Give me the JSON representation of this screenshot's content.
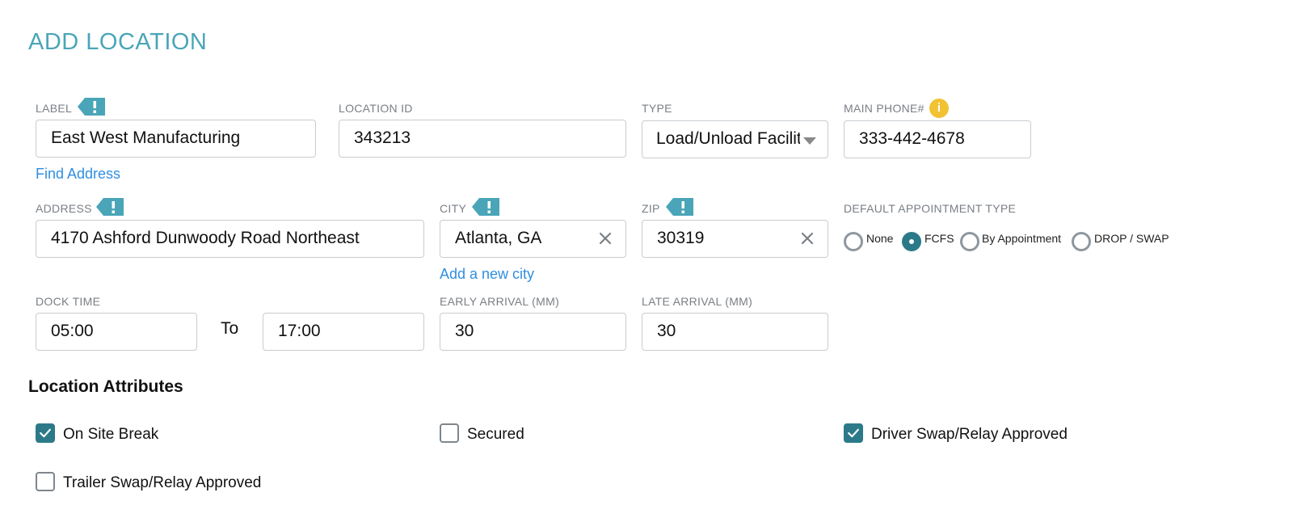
{
  "page_title": "ADD LOCATION",
  "fields": {
    "label": {
      "label": "LABEL",
      "value": "East West Manufacturing"
    },
    "location_id": {
      "label": "LOCATION ID",
      "value": "343213"
    },
    "type": {
      "label": "TYPE",
      "value": "Load/Unload Facility"
    },
    "main_phone": {
      "label": "MAIN PHONE#",
      "value": "333-442-4678"
    },
    "address": {
      "label": "ADDRESS",
      "value": "4170 Ashford Dunwoody Road Northeast"
    },
    "city": {
      "label": "CITY",
      "value": "Atlanta, GA"
    },
    "zip": {
      "label": "ZIP",
      "value": "30319"
    },
    "dock_time": {
      "label": "DOCK TIME",
      "from": "05:00",
      "to_text": "To",
      "to": "17:00"
    },
    "early_arrival": {
      "label": "EARLY ARRIVAL (MM)",
      "value": "30"
    },
    "late_arrival": {
      "label": "LATE ARRIVAL (MM)",
      "value": "30"
    }
  },
  "links": {
    "find_address": "Find Address",
    "add_city": "Add a new city"
  },
  "appointment": {
    "label": "DEFAULT APPOINTMENT TYPE",
    "options": [
      "None",
      "FCFS",
      "By Appointment",
      "DROP / SWAP"
    ],
    "selected": "FCFS"
  },
  "attributes": {
    "title": "Location Attributes",
    "items": [
      {
        "label": "On Site Break",
        "checked": true
      },
      {
        "label": "Secured",
        "checked": false
      },
      {
        "label": "Driver Swap/Relay Approved",
        "checked": true
      },
      {
        "label": "Trailer Swap/Relay Approved",
        "checked": false
      }
    ]
  },
  "icons": {
    "required": "required-flag-icon",
    "info": "info-icon",
    "clear": "clear-icon",
    "dropdown": "dropdown-arrow-icon",
    "check": "checkmark-icon"
  },
  "colors": {
    "title": "#4aa5b8",
    "flag": "#4aa5b8",
    "accent": "#2c7a89",
    "link": "#2f8fe0",
    "info": "#f2c232"
  }
}
